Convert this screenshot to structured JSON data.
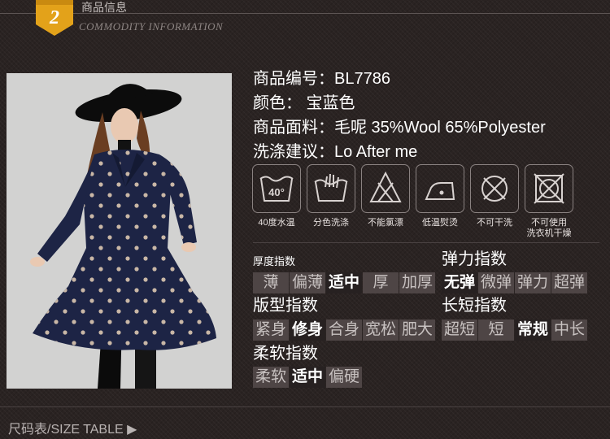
{
  "header": {
    "number": "2",
    "title_cn": "商品信息",
    "title_en": "COMMODITY INFORMATION"
  },
  "photo": {
    "icon": "model-photo",
    "coat_color": "#1d2445"
  },
  "info": {
    "code": "商品编号：BL7786",
    "color": "颜色： 宝蓝色",
    "fabric": "商品面料：毛呢 35%Wool 65%Polyester",
    "wash": "洗涤建议：Lo After me"
  },
  "care_icons": [
    {
      "icon": "wash-40-icon",
      "label": "40度水温",
      "text": "40°"
    },
    {
      "icon": "hand-wash-icon",
      "label": "分色洗涤"
    },
    {
      "icon": "no-bleach-icon",
      "label": "不能氯漂"
    },
    {
      "icon": "low-iron-icon",
      "label": "低温熨烫"
    },
    {
      "icon": "no-dry-clean-icon",
      "label": "不可干洗"
    },
    {
      "icon": "no-tumble-dry-icon",
      "label": "不可使用",
      "label2": "洗衣机干燥"
    }
  ],
  "thickness": {
    "title": "厚度指数",
    "options": [
      "薄",
      "偏薄",
      "适中",
      "厚",
      "加厚"
    ],
    "selected": "适中"
  },
  "elasticity": {
    "title": "弹力指数",
    "options": [
      "无弹",
      "微弹",
      "弹力",
      "超弹"
    ],
    "selected": "无弹"
  },
  "fit": {
    "title": "版型指数",
    "options": [
      "紧身",
      "修身",
      "合身",
      "宽松",
      "肥大"
    ],
    "selected": "修身"
  },
  "length": {
    "title": "长短指数",
    "options": [
      "超短",
      "短",
      "常规",
      "中长"
    ],
    "selected": "常规"
  },
  "softness": {
    "title": "柔软指数",
    "options": [
      "柔软",
      "适中",
      "偏硬"
    ],
    "selected": "适中"
  },
  "footer": {
    "label": "尺码表/SIZE TABLE ▶"
  },
  "colors": {
    "accent": "#e3a21a",
    "background": "#2a2322",
    "option_bg": "#4e4545",
    "option_selected_bg": "#272121"
  }
}
